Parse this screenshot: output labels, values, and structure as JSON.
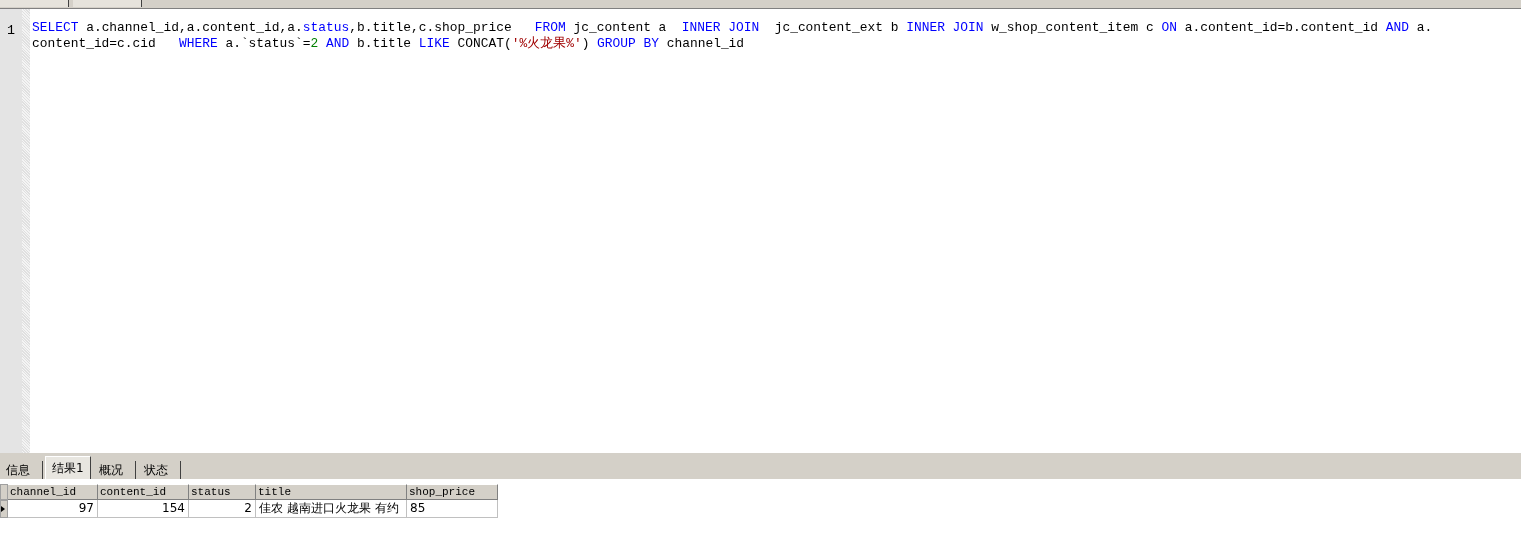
{
  "editor": {
    "line_number": "1",
    "lines": [
      [
        {
          "kind": "keyword",
          "text": "SELECT"
        },
        {
          "kind": "plain",
          "text": " a.channel_id,a.content_id,a."
        },
        {
          "kind": "keyword",
          "text": "status"
        },
        {
          "kind": "plain",
          "text": ",b.title,c.shop_price   "
        },
        {
          "kind": "keyword",
          "text": "FROM"
        },
        {
          "kind": "plain",
          "text": " jc_content a  "
        },
        {
          "kind": "keyword",
          "text": "INNER JOIN"
        },
        {
          "kind": "plain",
          "text": "  jc_content_ext b "
        },
        {
          "kind": "keyword",
          "text": "INNER JOIN"
        },
        {
          "kind": "plain",
          "text": " w_shop_content_item c "
        },
        {
          "kind": "keyword",
          "text": "ON"
        },
        {
          "kind": "plain",
          "text": " a.content_id=b.content_id "
        },
        {
          "kind": "keyword",
          "text": "AND"
        },
        {
          "kind": "plain",
          "text": " a."
        }
      ],
      [
        {
          "kind": "plain",
          "text": "content_id=c.cid   "
        },
        {
          "kind": "keyword",
          "text": "WHERE"
        },
        {
          "kind": "plain",
          "text": " a.`status`="
        },
        {
          "kind": "number",
          "text": "2"
        },
        {
          "kind": "keyword",
          "text": " AND"
        },
        {
          "kind": "plain",
          "text": " b.title "
        },
        {
          "kind": "keyword",
          "text": "LIKE"
        },
        {
          "kind": "plain",
          "text": " CONCAT("
        },
        {
          "kind": "string",
          "text": "'%火龙果%'"
        },
        {
          "kind": "plain",
          "text": ") "
        },
        {
          "kind": "keyword",
          "text": "GROUP BY"
        },
        {
          "kind": "plain",
          "text": " channel_id"
        }
      ]
    ]
  },
  "tabs": [
    {
      "label": "信息",
      "selected": false
    },
    {
      "label": "结果1",
      "selected": true
    },
    {
      "label": "概况",
      "selected": false
    },
    {
      "label": "状态",
      "selected": false
    }
  ],
  "table": {
    "columns": [
      "channel_id",
      "content_id",
      "status",
      "title",
      "shop_price"
    ],
    "rows": [
      {
        "current": true,
        "cells": [
          {
            "kind": "number",
            "text": "97"
          },
          {
            "kind": "number",
            "text": "154"
          },
          {
            "kind": "number",
            "text": "2"
          },
          {
            "kind": "text",
            "text": "佳农 越南进口火龙果  有约"
          },
          {
            "kind": "text",
            "text": "85"
          }
        ]
      }
    ]
  }
}
